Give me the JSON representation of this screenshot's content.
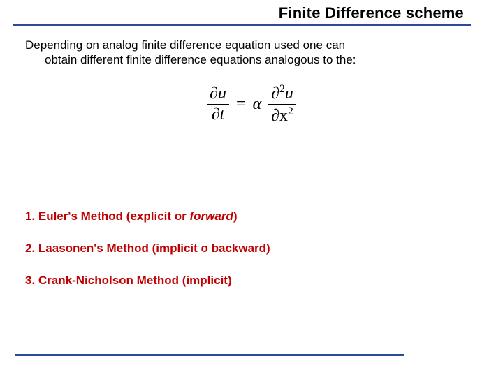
{
  "title": "Finite Difference scheme",
  "intro": {
    "line1": "Depending on analog finite difference equation used one can",
    "line2": "obtain different finite difference equations analogous to the:"
  },
  "equation": {
    "lhs_num": "∂u",
    "lhs_den": "∂t",
    "eq": "=",
    "alpha": "α",
    "rhs_num_partial": "∂",
    "rhs_num_sup": "2",
    "rhs_num_var": "u",
    "rhs_den_partial": "∂x",
    "rhs_den_sup": "2"
  },
  "methods": {
    "m1_prefix": "1. Euler's Method (explicit or ",
    "m1_italic": "forward",
    "m1_suffix": ")",
    "m2": "2. Laasonen's Method (implicit o backward)",
    "m3": "3. Crank-Nicholson Method (implicit)"
  }
}
